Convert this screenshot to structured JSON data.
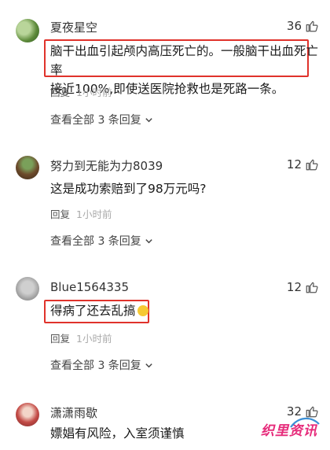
{
  "comments": [
    {
      "username": "夏夜星空",
      "likes": "36",
      "text_lines": [
        "脑干出血引起颅内高压死亡的。一般脑干出血死亡率",
        "接近100%,即使送医院抢救也是死路一条。"
      ],
      "reply_label": "回复",
      "time": "1小时前",
      "view_replies": "查看全部 3 条回复"
    },
    {
      "username": "努力到无能为力8039",
      "likes": "12",
      "text_lines": [
        "这是成功索赔到了98万元吗?"
      ],
      "reply_label": "回复",
      "time": "1小时前",
      "view_replies": "查看全部 3 条回复"
    },
    {
      "username": "Blue1564335",
      "likes": "12",
      "text_lines": [
        "得病了还去乱搞"
      ],
      "reply_label": "回复",
      "time": "1小时前",
      "view_replies": "查看全部 3 条回复"
    },
    {
      "username": "潇潇雨歇",
      "likes": "32",
      "text_lines": [
        "嫖娼有风险，入室须谨慎"
      ]
    }
  ],
  "watermark": {
    "text": "织里资讯",
    "color": "#e62a7a"
  },
  "colors": {
    "highlight": "#e0322b"
  },
  "icons": {
    "like": "thumbs-up-icon",
    "expand": "chevron-down-icon",
    "emoji": "smiling-face-emoji-icon"
  }
}
